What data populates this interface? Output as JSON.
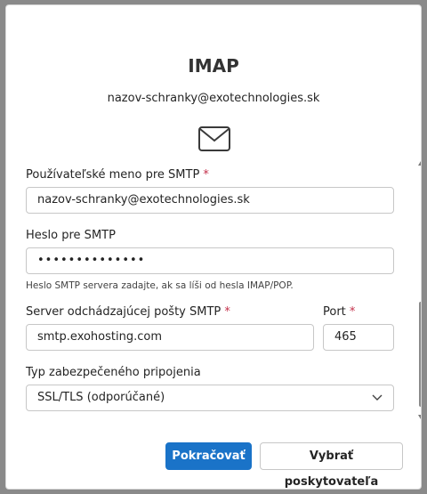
{
  "dialog": {
    "title": "IMAP",
    "email": "nazov-schranky@exotechnologies.sk",
    "icon": "mail-icon"
  },
  "form": {
    "smtp_username": {
      "label": "Používateľské meno pre SMTP",
      "required_mark": "*",
      "value": "nazov-schranky@exotechnologies.sk"
    },
    "smtp_password": {
      "label": "Heslo pre SMTP",
      "value": "••••••••••••••",
      "hint": "Heslo SMTP servera zadajte, ak sa líši od hesla IMAP/POP."
    },
    "smtp_server": {
      "label": "Server odchádzajúcej pošty SMTP",
      "required_mark": "*",
      "value": "smtp.exohosting.com"
    },
    "port": {
      "label": "Port",
      "required_mark": "*",
      "value": "465"
    },
    "security": {
      "label": "Typ zabezpečeného pripojenia",
      "selected": "SSL/TLS (odporúčané)"
    }
  },
  "buttons": {
    "continue": "Pokračovať",
    "choose_provider": "Vybrať poskytovateľa"
  },
  "colors": {
    "primary": "#1a73c8",
    "required": "#c4314b"
  }
}
